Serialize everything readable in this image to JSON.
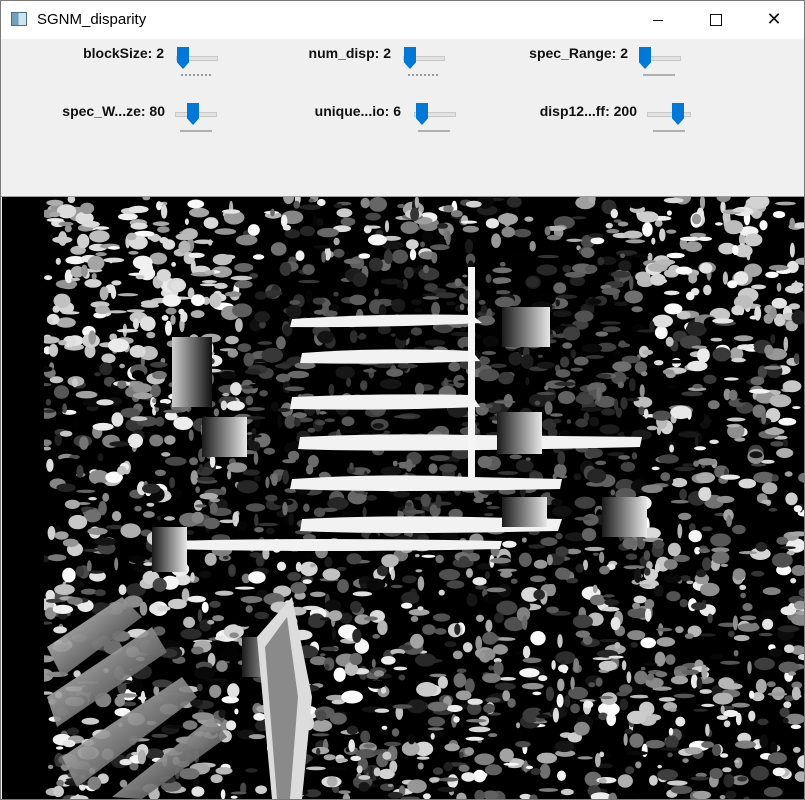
{
  "window": {
    "title": "SGNM_disparity",
    "buttons": {
      "minimize_icon": "minimize-icon",
      "maximize_icon": "maximize-icon",
      "close_icon": "close-icon"
    }
  },
  "trackbars": [
    {
      "label": "blockSize: 2"
    },
    {
      "label": "num_disp: 2"
    },
    {
      "label": "spec_Range: 2"
    },
    {
      "label": "spec_W...ze: 80"
    },
    {
      "label": "unique...io: 6"
    },
    {
      "label": "disp12...ff: 200"
    }
  ],
  "colors": {
    "accent": "#0078d7",
    "panel": "#f0f0f0",
    "image_bg": "#000000"
  }
}
